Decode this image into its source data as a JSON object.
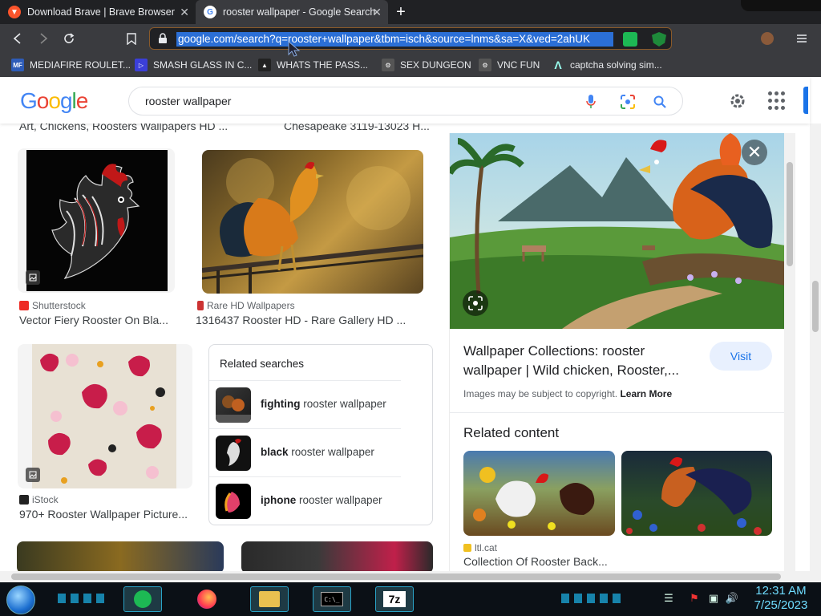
{
  "tabs": [
    {
      "title": "Download Brave | Brave Browser",
      "active": false
    },
    {
      "title": "rooster wallpaper - Google Search",
      "active": true
    }
  ],
  "address_bar": {
    "url": "google.com/search?q=rooster+wallpaper&tbm=isch&source=lnms&sa=X&ved=2ahUK"
  },
  "bookmarks": [
    {
      "label": "MEDIAFIRE ROULET...",
      "icon": "mediafire-icon"
    },
    {
      "label": "SMASH GLASS IN C...",
      "icon": "smash-icon"
    },
    {
      "label": "WHATS THE PASS...",
      "icon": "pass-icon"
    },
    {
      "label": "SEX DUNGEON",
      "icon": "dungeon-icon"
    },
    {
      "label": "VNC FUN",
      "icon": "vnc-icon"
    },
    {
      "label": "captcha solving sim...",
      "icon": "captcha-icon"
    }
  ],
  "google": {
    "logo": "Google",
    "query": "rooster wallpaper"
  },
  "results": {
    "top_captions": [
      "Art, Chickens, Roosters Wallpapers HD ...",
      "Chesapeake 3119-13023 H..."
    ],
    "items": [
      {
        "source": "Shutterstock",
        "caption": "Vector Fiery Rooster On Bla..."
      },
      {
        "source": "Rare HD Wallpapers",
        "caption": "1316437 Rooster HD - Rare Gallery HD ..."
      },
      {
        "source": "iStock",
        "caption": "970+ Rooster Wallpaper Picture..."
      }
    ]
  },
  "related_searches": {
    "title": "Related searches",
    "items": [
      {
        "bold": "fighting",
        "rest": " rooster wallpaper"
      },
      {
        "bold": "black",
        "rest": " rooster wallpaper"
      },
      {
        "bold": "iphone",
        "rest": " rooster wallpaper"
      }
    ]
  },
  "panel": {
    "title": "Wallpaper Collections: rooster wallpaper | Wild chicken, Rooster,...",
    "visit_label": "Visit",
    "copyright_text": "Images may be subject to copyright.",
    "learn_more": "Learn More",
    "related_content_title": "Related content",
    "related_source": "ltl.cat",
    "related_caption": "Collection Of Rooster Back..."
  },
  "taskbar": {
    "time": "12:31 AM",
    "date": "7/25/2023"
  }
}
